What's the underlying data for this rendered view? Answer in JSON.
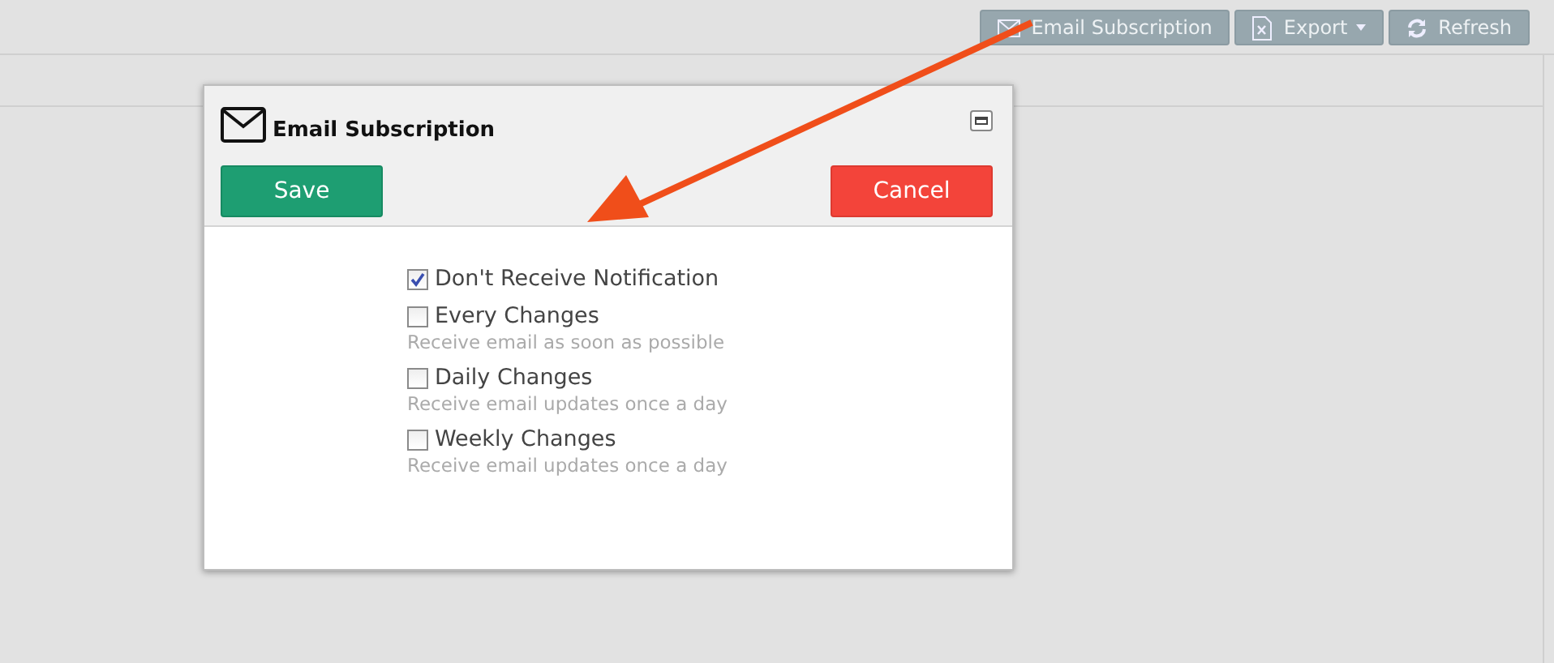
{
  "toolbar": {
    "buttons": [
      {
        "label": "Email Subscription",
        "kind": "mail"
      },
      {
        "label": "Export",
        "kind": "excel",
        "dropdown": true
      },
      {
        "label": "Refresh",
        "kind": "refresh"
      }
    ]
  },
  "dialog": {
    "title": "Email Subscription",
    "save": "Save",
    "cancel": "Cancel",
    "options": [
      {
        "label": "Don't Receive Notification",
        "checked": true
      },
      {
        "label": "Every Changes",
        "description": "Receive email as soon as possible",
        "checked": false
      },
      {
        "label": "Daily Changes",
        "description": "Receive email updates once a day",
        "checked": false
      },
      {
        "label": "Weekly Changes",
        "description": "Receive email updates once a day",
        "checked": false
      }
    ]
  }
}
